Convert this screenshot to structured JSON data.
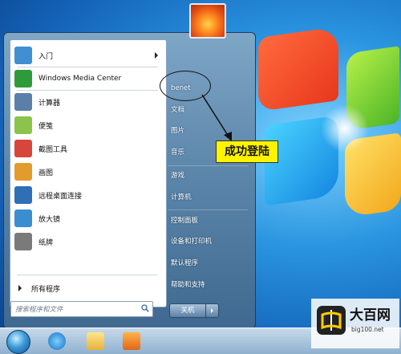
{
  "start_menu": {
    "programs": [
      {
        "label": "入门",
        "icon": "getting-started-icon",
        "color": "#3f8fd2",
        "submenu": true
      },
      {
        "label": "Windows Media Center",
        "icon": "media-center-icon",
        "color": "#2e9b3a",
        "submenu": false
      },
      {
        "label": "计算器",
        "icon": "calculator-icon",
        "color": "#5b7fa8",
        "submenu": false
      },
      {
        "label": "便笺",
        "icon": "sticky-notes-icon",
        "color": "#8bc44a",
        "submenu": false
      },
      {
        "label": "截图工具",
        "icon": "snipping-tool-icon",
        "color": "#d8453b",
        "submenu": false
      },
      {
        "label": "画图",
        "icon": "paint-icon",
        "color": "#e39b2d",
        "submenu": false
      },
      {
        "label": "远程桌面连接",
        "icon": "remote-desktop-icon",
        "color": "#2f6fb5",
        "submenu": false
      },
      {
        "label": "放大镜",
        "icon": "magnifier-icon",
        "color": "#3a8ed0",
        "submenu": false
      },
      {
        "label": "纸牌",
        "icon": "solitaire-icon",
        "color": "#7a7a7a",
        "submenu": false
      }
    ],
    "all_programs": "所有程序",
    "search_placeholder": "搜索程序和文件",
    "right_items_top": [
      "benet",
      "文档",
      "图片",
      "音乐"
    ],
    "right_items_mid": [
      "游戏",
      "计算机"
    ],
    "right_items_bottom": [
      "控制面板",
      "设备和打印机",
      "默认程序",
      "帮助和支持"
    ],
    "shutdown": "关机"
  },
  "annotation": {
    "callout_text": "成功登陆",
    "callout_color": "#fff300"
  },
  "watermark": {
    "title": "大百网",
    "url": "big100.net"
  }
}
